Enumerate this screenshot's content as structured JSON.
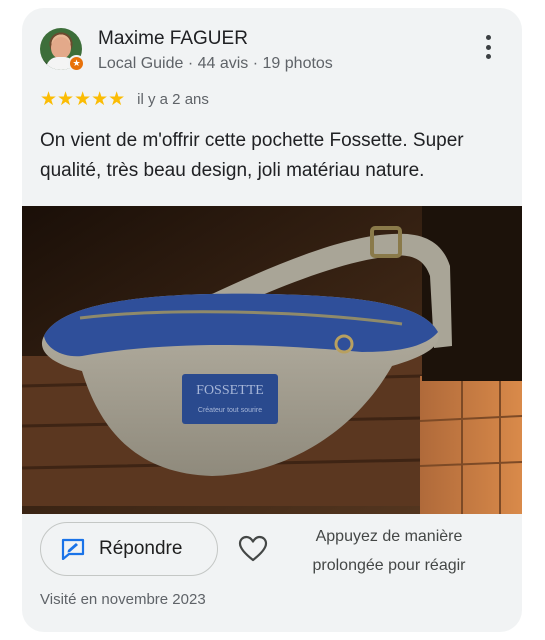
{
  "reviewer": {
    "name": "Maxime FAGUER",
    "meta": "Local Guide · 44 avis · 19 photos",
    "avatar_icon": "user-avatar",
    "badge_icon": "local-guide-star-icon"
  },
  "rating": {
    "stars": "★★★★★",
    "value": 5,
    "max": 5,
    "time_ago": "il y a 2 ans"
  },
  "review_text": "On vient de m'offrir cette pochette Fossette. Super qualité, très beau design, joli matériau nature.",
  "photo": {
    "label_text": "FOSSETTE",
    "label_subtext": "Créateur tout sourire"
  },
  "actions": {
    "reply_label": "Répondre",
    "reply_icon": "edit-reply-icon",
    "like_icon": "heart-outline-icon",
    "hint": "Appuyez de manière prolongée pour réagir"
  },
  "visited": "Visité en novembre 2023",
  "colors": {
    "card_bg": "#f1f3f4",
    "star": "#fbbc04",
    "badge": "#e8710a",
    "reply_icon": "#1a73e8"
  }
}
